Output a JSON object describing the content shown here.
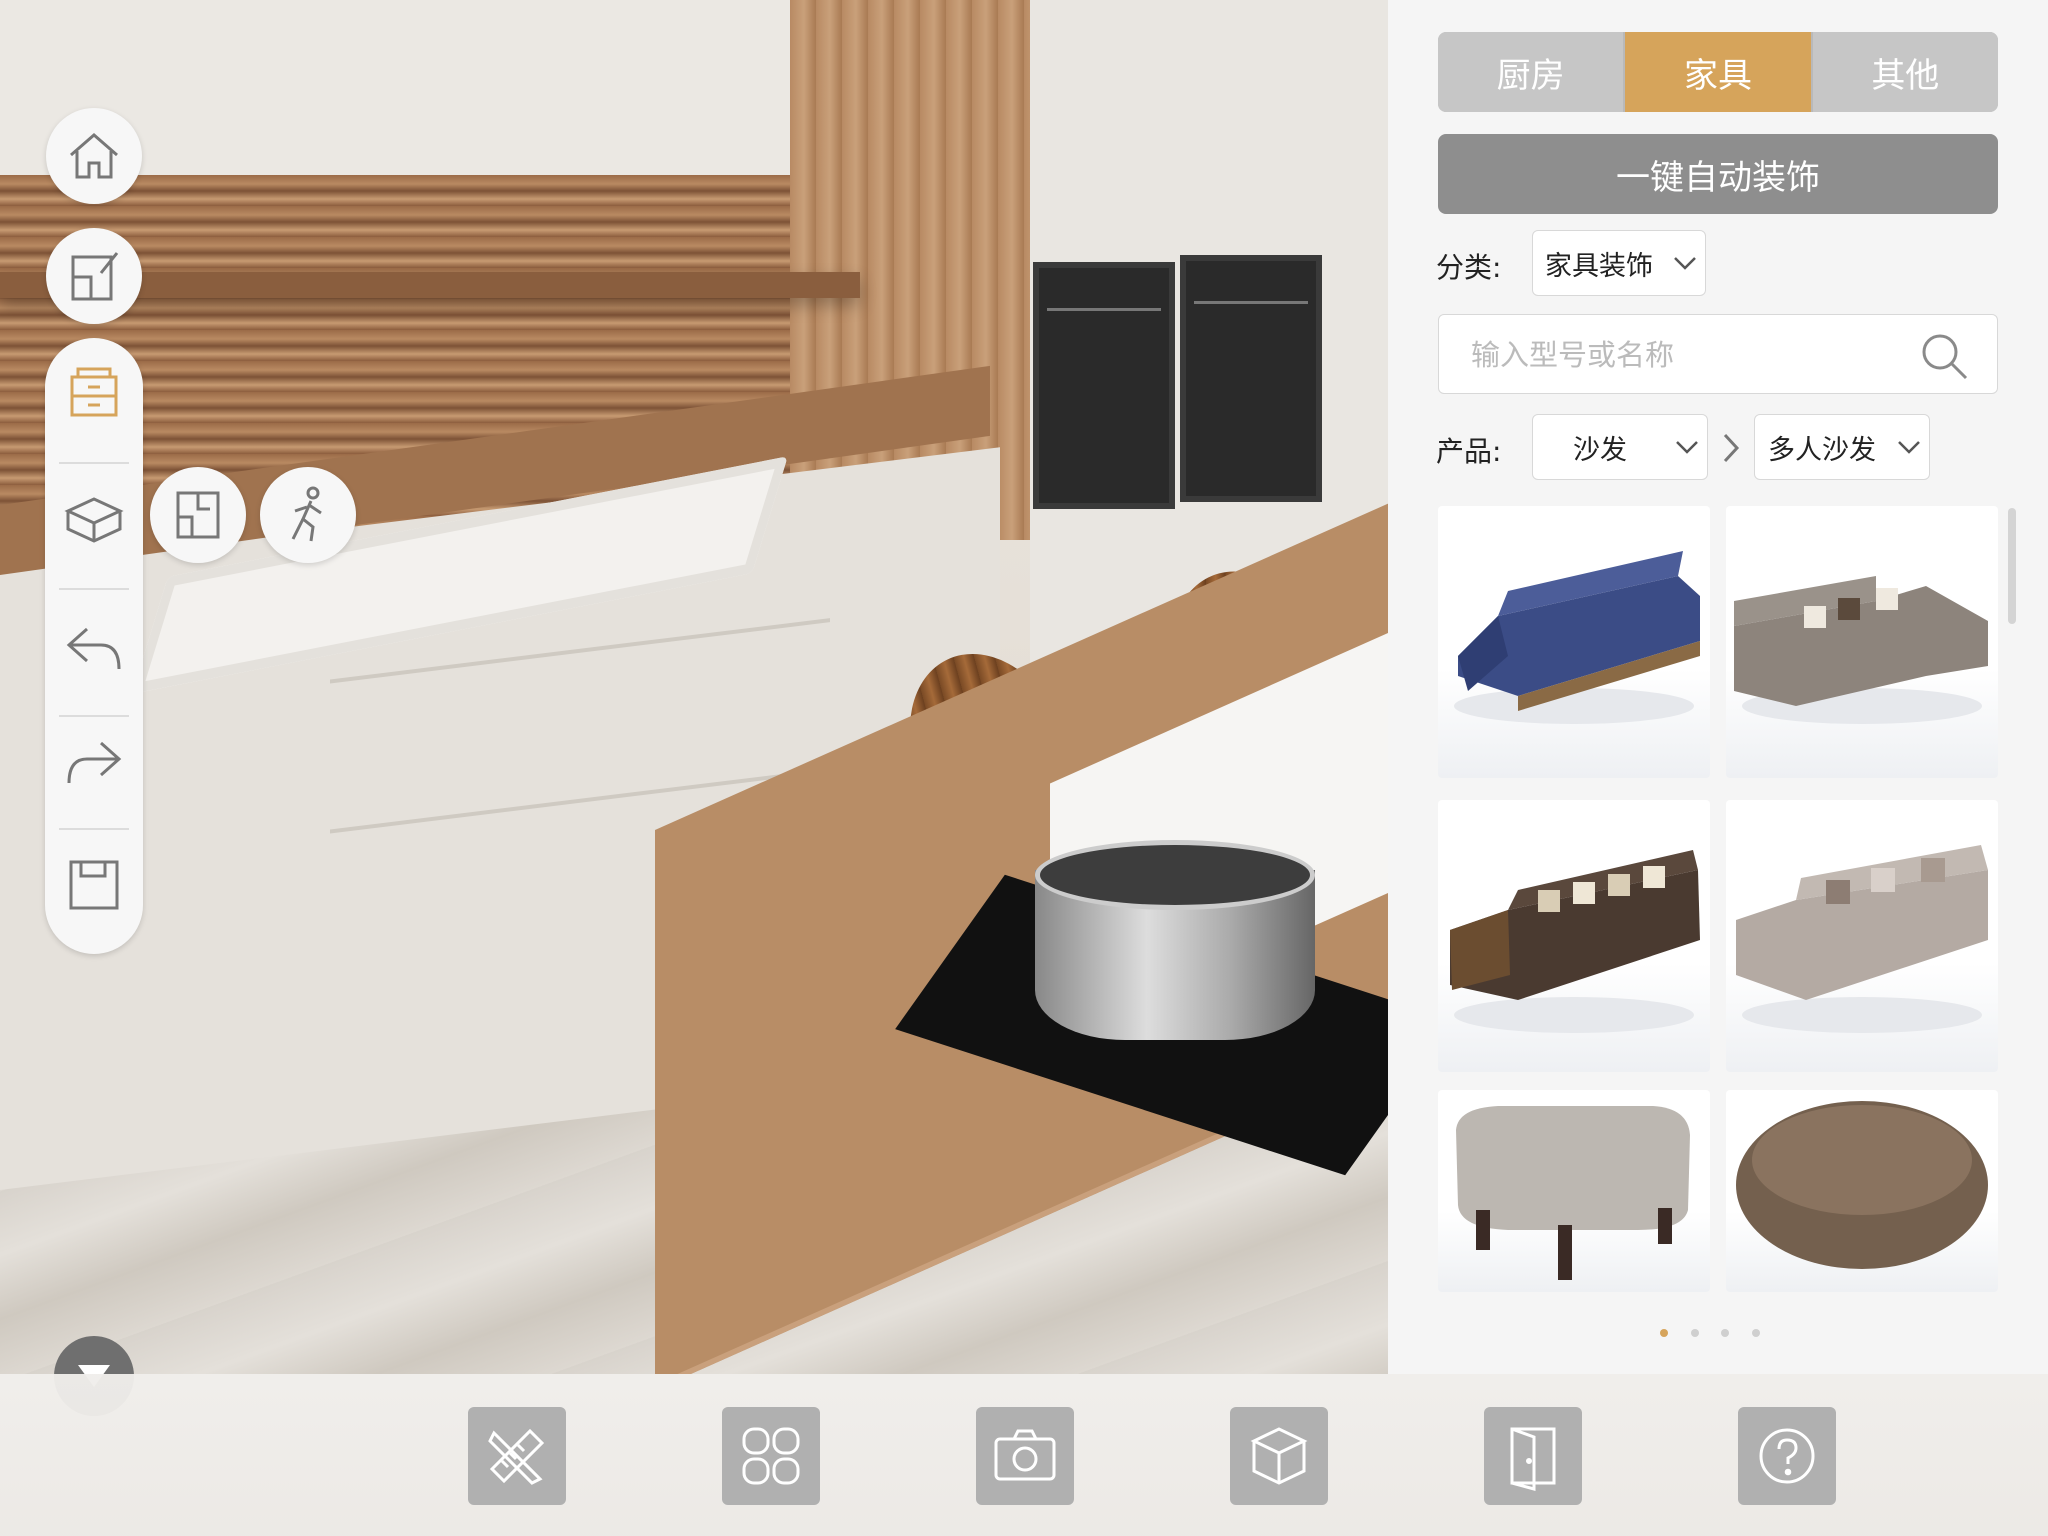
{
  "left_toolbar": {
    "home": "home-icon",
    "edit_floorplan": "floorplan-edit-icon",
    "cabinet_view": "cabinet-icon",
    "3d_box_view": "box-3d-icon",
    "floorplan_2d": "floorplan-icon",
    "walk_mode": "walking-person-icon",
    "undo": "undo-icon",
    "redo": "redo-icon",
    "save": "save-icon",
    "collapse": "chevron-down-icon"
  },
  "panel": {
    "tabs": [
      {
        "label": "厨房",
        "active": false
      },
      {
        "label": "家具",
        "active": true
      },
      {
        "label": "其他",
        "active": false
      }
    ],
    "auto_decorate_label": "一键自动装饰",
    "category": {
      "label": "分类:",
      "value": "家具装饰"
    },
    "search": {
      "placeholder": "输入型号或名称",
      "value": ""
    },
    "product": {
      "label": "产品:",
      "primary": "沙发",
      "secondary": "多人沙发"
    },
    "products": [
      {
        "name": "blue-sofa"
      },
      {
        "name": "grey-l-sofa"
      },
      {
        "name": "brown-sofa"
      },
      {
        "name": "light-grey-sofa"
      },
      {
        "name": "ottoman"
      },
      {
        "name": "round-pouf"
      }
    ],
    "pager": {
      "pages": 4,
      "current": 1
    }
  },
  "bottom_bar": [
    {
      "icon": "ruler-pencil-icon"
    },
    {
      "icon": "grid-four-icon"
    },
    {
      "icon": "camera-icon"
    },
    {
      "icon": "cube-icon"
    },
    {
      "icon": "door-icon"
    },
    {
      "icon": "help-icon"
    }
  ],
  "colors": {
    "accent": "#d6a45b",
    "tab_inactive": "#c6c6c6",
    "button_grey": "#8e8e8e",
    "bottom_button": "#b0b0b0"
  }
}
